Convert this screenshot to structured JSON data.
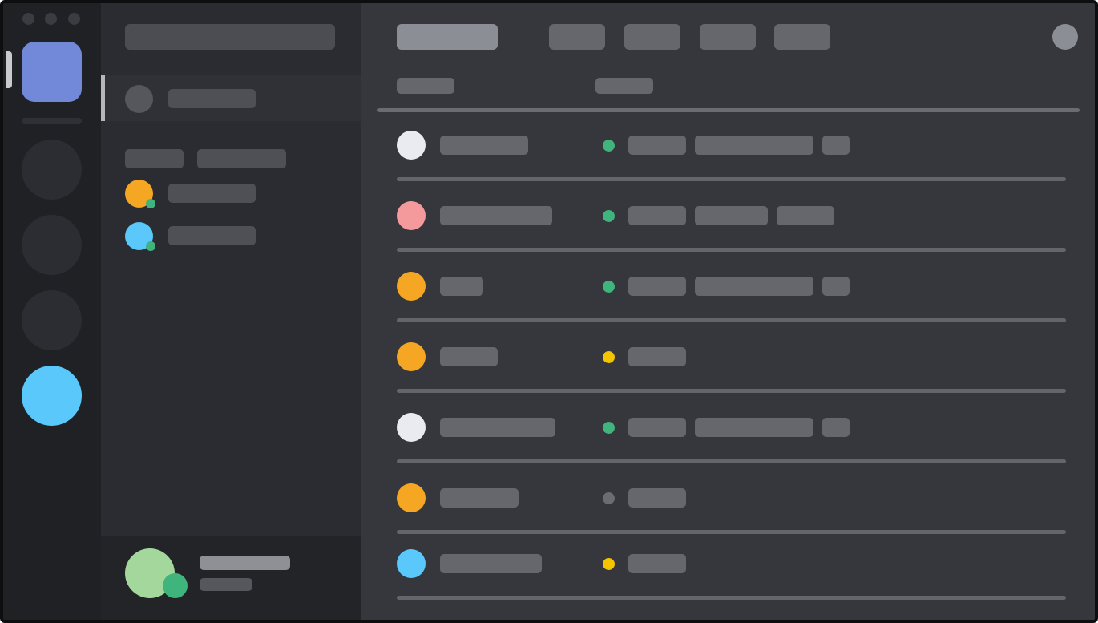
{
  "window": {
    "controls": [
      "close",
      "minimize",
      "maximize"
    ]
  },
  "colors": {
    "rail_bg": "#1f2125",
    "sidebar_bg": "#2a2c31",
    "main_bg": "#35373c",
    "placeholder": "#65676c",
    "accent_blurple": "#7289da",
    "status_online": "#3fb47c",
    "status_idle": "#f5c400",
    "status_offline": "#6a6c70"
  },
  "servers": [
    {
      "name": "home",
      "color": "#7289da",
      "selected": true
    },
    {
      "name": "server-1",
      "color": "#2b2d32"
    },
    {
      "name": "server-2",
      "color": "#2b2d32"
    },
    {
      "name": "server-3",
      "color": "#2b2d32"
    },
    {
      "name": "server-4",
      "color": "#5ac8fa"
    }
  ],
  "sidebar": {
    "dm_list": [
      {
        "avatar_color": "#f5a623",
        "status": "online"
      },
      {
        "avatar_color": "#5ac8fa",
        "status": "online"
      }
    ]
  },
  "user_panel": {
    "avatar_color": "#a4d79b",
    "status": "online"
  },
  "header": {
    "tabs": [
      "tab-1",
      "tab-2",
      "tab-3",
      "tab-4",
      "tab-5"
    ],
    "active_tab": 0
  },
  "members": [
    {
      "avatar_color": "#e9ebf0",
      "status": "online"
    },
    {
      "avatar_color": "#f49a9c",
      "status": "online"
    },
    {
      "avatar_color": "#f5a623",
      "status": "online"
    },
    {
      "avatar_color": "#f5a623",
      "status": "idle"
    },
    {
      "avatar_color": "#e9ebf0",
      "status": "online"
    },
    {
      "avatar_color": "#f5a623",
      "status": "offline"
    },
    {
      "avatar_color": "#5ac8fa",
      "status": "idle"
    }
  ]
}
